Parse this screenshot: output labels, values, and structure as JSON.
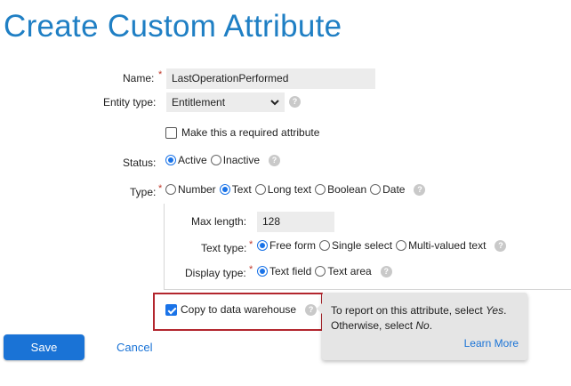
{
  "page": {
    "title": "Create Custom Attribute"
  },
  "fields": {
    "name": {
      "label": "Name:",
      "required_mark": "*",
      "value": "LastOperationPerformed"
    },
    "entity_type": {
      "label": "Entity type:",
      "value": "Entitlement"
    },
    "required_checkbox": {
      "label": "Make this a required attribute",
      "checked": false
    },
    "status": {
      "label": "Status:",
      "options": [
        "Active",
        "Inactive"
      ],
      "selected": "Active"
    },
    "type": {
      "label": "Type:",
      "required_mark": "*",
      "options": [
        "Number",
        "Text",
        "Long text",
        "Boolean",
        "Date"
      ],
      "selected": "Text"
    },
    "max_length": {
      "label": "Max length:",
      "value": "128"
    },
    "text_type": {
      "label": "Text type:",
      "required_mark": "*",
      "options": [
        "Free form",
        "Single select",
        "Multi-valued text"
      ],
      "selected": "Free form"
    },
    "display_type": {
      "label": "Display type:",
      "required_mark": "*",
      "options": [
        "Text field",
        "Text area"
      ],
      "selected": "Text field"
    },
    "copy_to_warehouse": {
      "label": "Copy to data warehouse",
      "checked": true
    }
  },
  "tooltip": {
    "line1_prefix": "To report on this attribute, select ",
    "line1_emph": "Yes",
    "line1_suffix": ".",
    "line2_prefix": "Otherwise, select ",
    "line2_emph": "No",
    "line2_suffix": ".",
    "link": "Learn More"
  },
  "actions": {
    "save": "Save",
    "cancel": "Cancel"
  },
  "icons": {
    "help": "help-icon",
    "dropdown": "chevron-down-icon"
  },
  "colors": {
    "accent": "#1a73d6",
    "title": "#1f7fc4",
    "highlight": "#b3262e"
  }
}
